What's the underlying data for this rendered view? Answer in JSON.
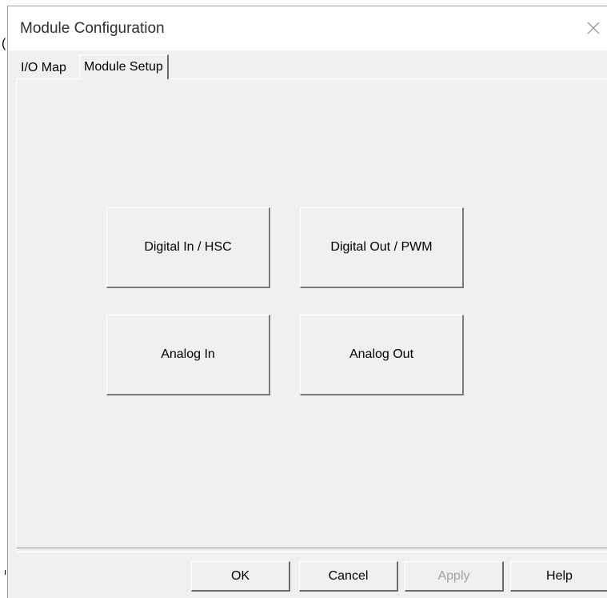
{
  "window": {
    "title": "Module Configuration"
  },
  "background": {
    "partial_glyph": "("
  },
  "tabs": [
    {
      "label": "I/O Map",
      "active": false
    },
    {
      "label": "Module Setup",
      "active": true
    }
  ],
  "setup_buttons": {
    "digital_in": "Digital In / HSC",
    "digital_out": "Digital Out / PWM",
    "analog_in": "Analog In",
    "analog_out": "Analog Out"
  },
  "footer": {
    "ok": "OK",
    "cancel": "Cancel",
    "apply": "Apply",
    "help": "Help"
  },
  "icons": {
    "close": "close-icon"
  }
}
